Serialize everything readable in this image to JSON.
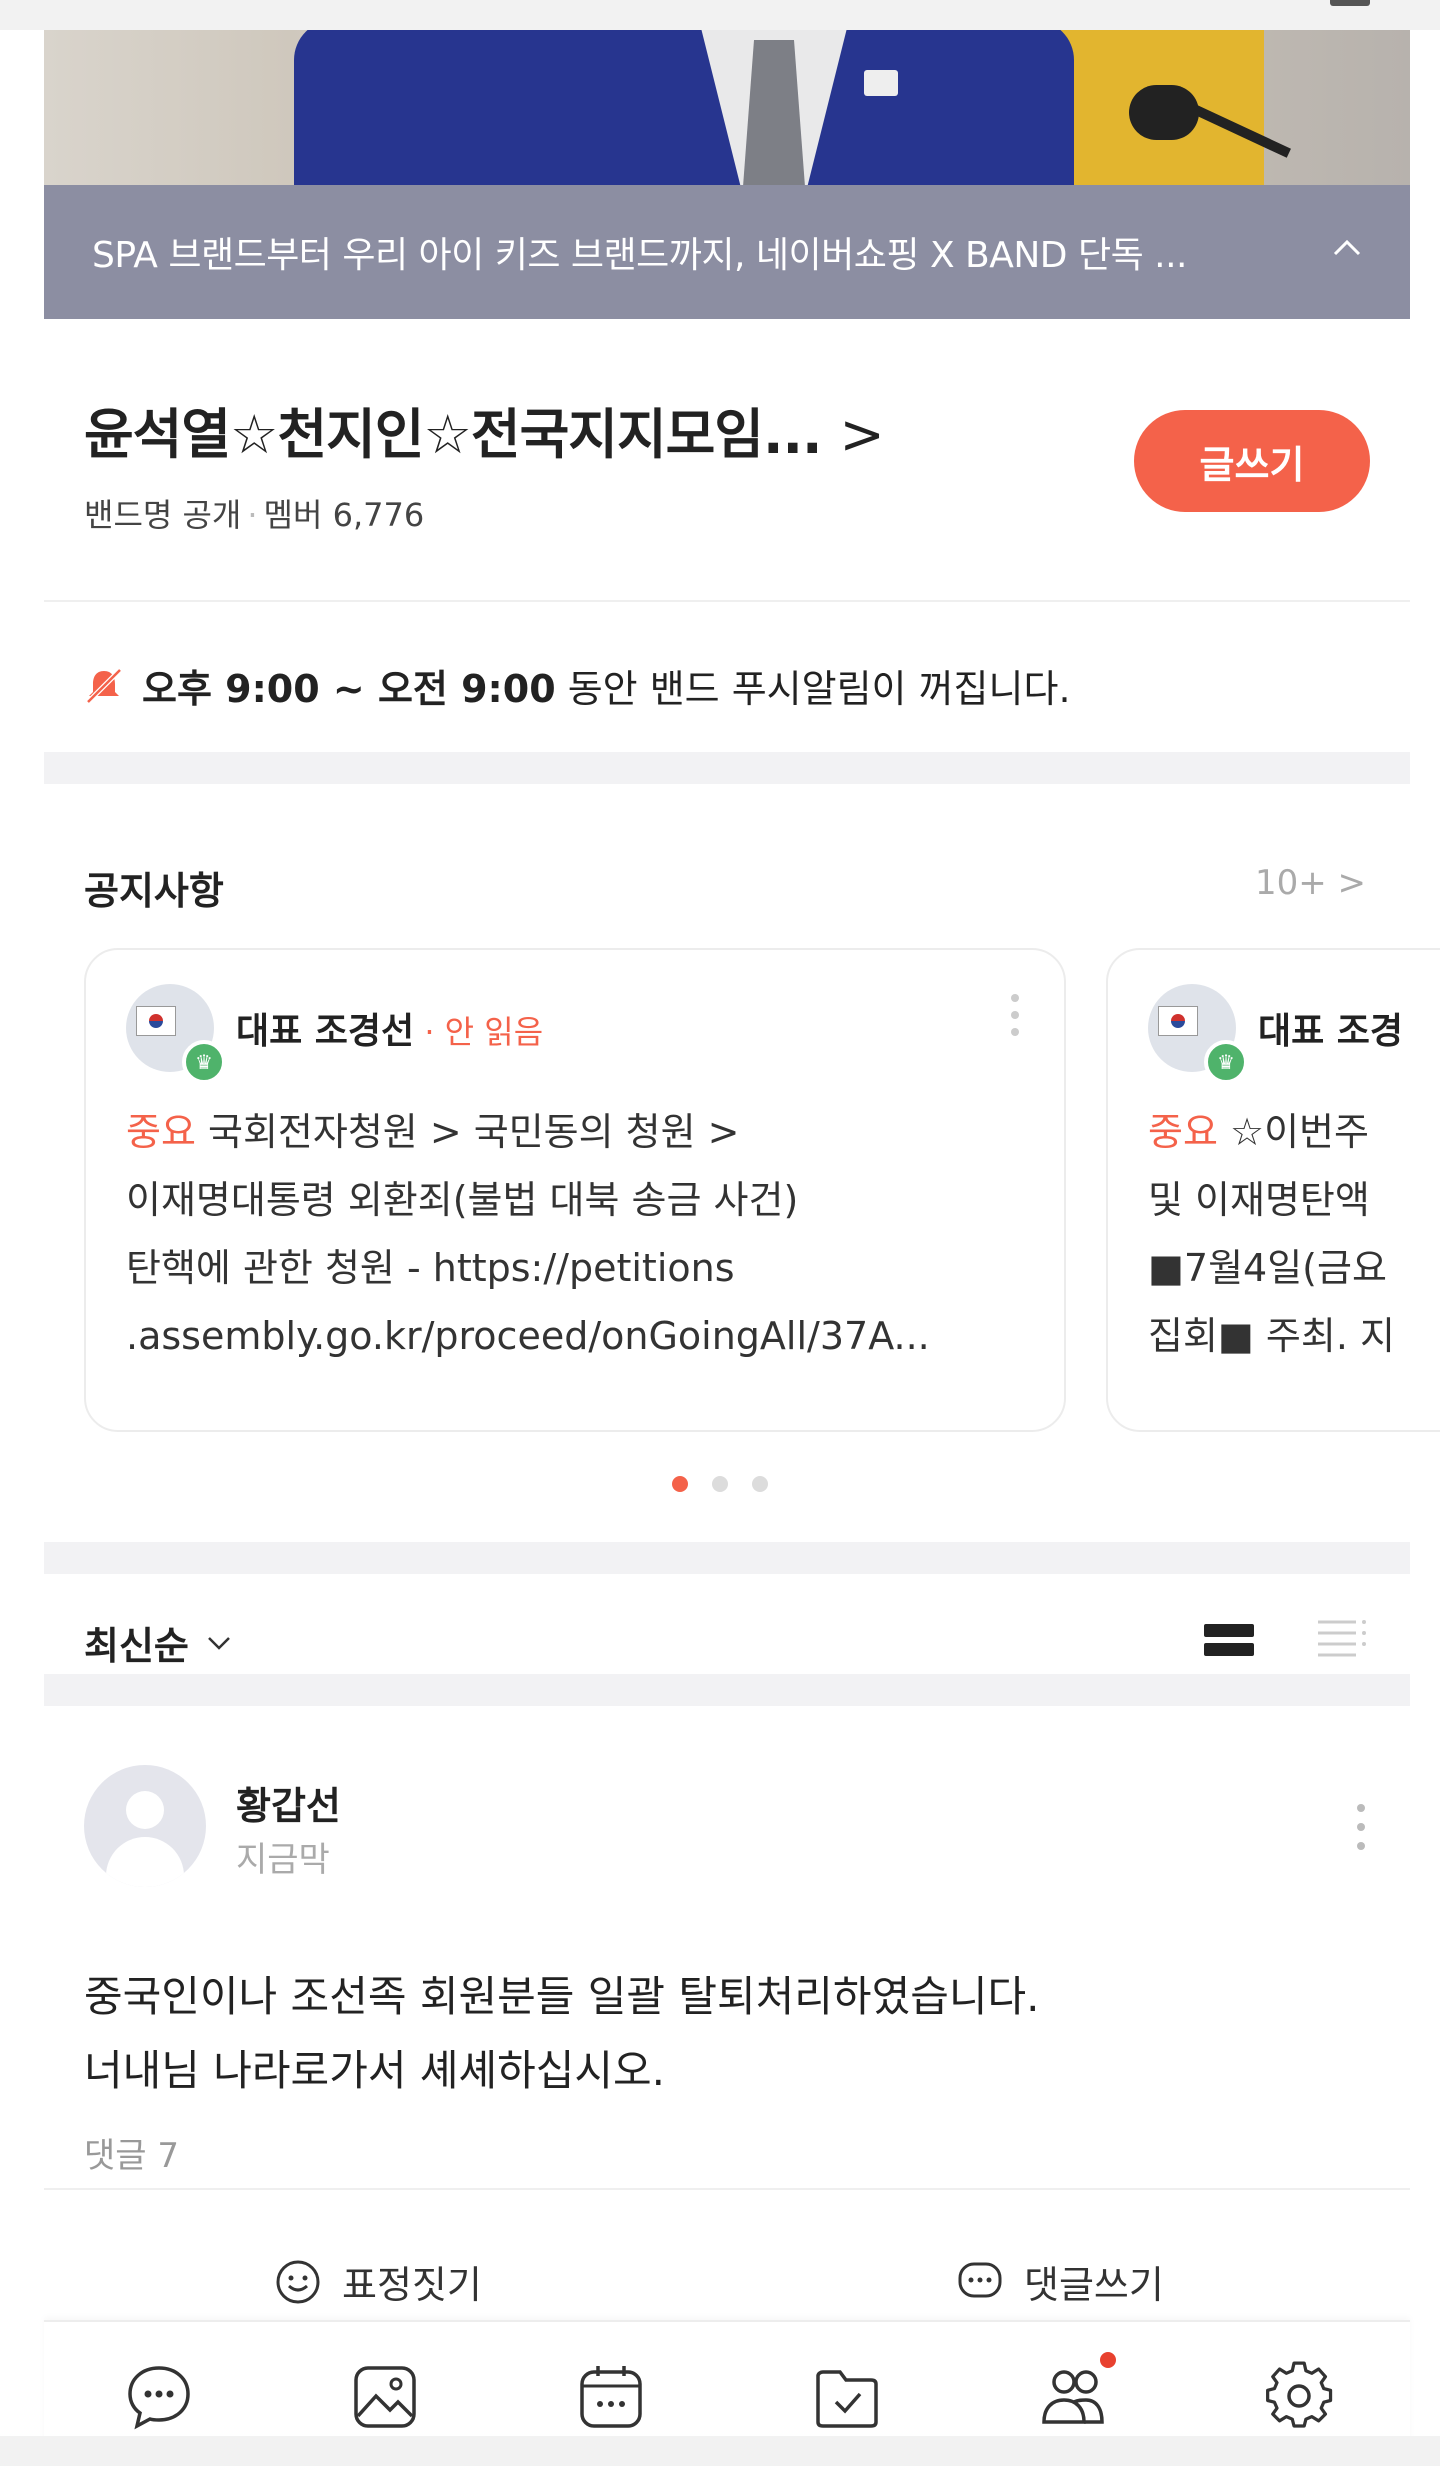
{
  "promo": {
    "text": "SPA 브랜드부터 우리 아이 키즈 브랜드까지, 네이버쇼핑 X BAND 단독 ..."
  },
  "band": {
    "title": "윤석열☆천지인☆전국지지모임...",
    "title_chevron": ">",
    "visibility": "밴드명 공개",
    "members": "멤버 6,776",
    "write_label": "글쓰기"
  },
  "mute_notice": {
    "time_range": "오후 9:00 ~ 오전 9:00",
    "suffix": " 동안 밴드 푸시알림이 꺼집니다."
  },
  "notices": {
    "heading": "공지사항",
    "more": "10+ >",
    "cards": [
      {
        "author": "대표 조경선",
        "status": " · 안 읽음",
        "tag": "중요",
        "body_lines": [
          " 국회전자청원 > 국민동의 청원 >",
          "이재명대통령 외환죄(불법 대북 송금 사건)",
          "탄핵에 관한 청원 - https://petitions",
          ".assembly.go.kr/proceed/onGoingAll/37A..."
        ]
      },
      {
        "author": "대표 조경",
        "tag": "중요",
        "body_lines": [
          " ☆이번주",
          "및 이재명탄액",
          "■7월4일(금요",
          "집회■ 주최. 지"
        ]
      }
    ],
    "pager": {
      "count": 3,
      "active": 0
    }
  },
  "sort": {
    "label": "최신순"
  },
  "post": {
    "author": "황갑선",
    "time": "지금막",
    "text_lines": [
      "중국인이나 조선족 회원분들 일괄 탈퇴처리하였습니다.",
      "너내님 나라로가서 셰셰하십시오."
    ],
    "comments": "댓글 7",
    "react_label": "표정짓기",
    "comment_label": "댓글쓰기"
  },
  "tabbar": {
    "items": [
      {
        "icon": "chat-icon"
      },
      {
        "icon": "photo-icon"
      },
      {
        "icon": "calendar-icon"
      },
      {
        "icon": "checklist-icon"
      },
      {
        "icon": "members-icon",
        "has_badge": true
      },
      {
        "icon": "settings-icon"
      }
    ]
  },
  "colors": {
    "accent": "#f4624a",
    "promo_bg": "#8c8ea2",
    "badge_green": "#4fb36b",
    "muted_text": "#aaaaaa"
  }
}
